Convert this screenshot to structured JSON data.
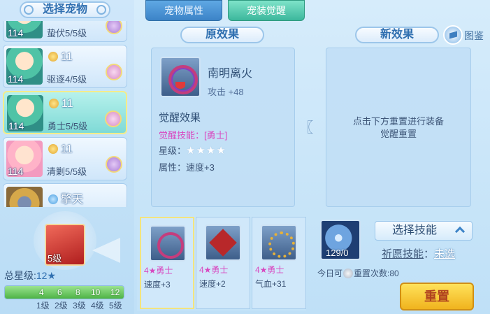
{
  "left": {
    "title": "选择宠物",
    "pets": [
      {
        "level": "114",
        "power": "",
        "skill": "蛰伏5/5级"
      },
      {
        "level": "114",
        "power": "11",
        "skill": "驱逐4/5级"
      },
      {
        "level": "114",
        "power": "11",
        "skill": "勇士5/5级",
        "selected": true
      },
      {
        "level": "114",
        "power": "11",
        "skill": "清剿5/5级"
      },
      {
        "level": "",
        "power": "擎天",
        "skill": ""
      }
    ],
    "char_level": "5级",
    "total_stars_label": "总星级:",
    "total_stars_value": "12★",
    "progress_fraction": 1.0,
    "ticks": [
      "4",
      "6",
      "8",
      "10",
      "12"
    ],
    "levels": [
      "1级",
      "2级",
      "3级",
      "4级",
      "5级"
    ]
  },
  "tabs": {
    "pet_attr": "宠物属性",
    "pet_gear_awaken": "宠装觉醒"
  },
  "original": {
    "section": "原效果",
    "item_name": "南明离火",
    "item_stat": "攻击 +48",
    "awaken_title": "觉醒效果",
    "awaken_skill": "觉醒技能：[勇士]",
    "star_label": "星级：",
    "stars": "★★★★",
    "attr": "属性：速度+3"
  },
  "new": {
    "section": "新效果",
    "atlas": "图鉴",
    "hint_line1": "点击下方重置进行装备",
    "hint_line2": "觉醒重置"
  },
  "candidates": [
    {
      "tag": "4★勇士",
      "stat": "速度+3",
      "icon": "ruby-necklace-icon"
    },
    {
      "tag": "4★勇士",
      "stat": "速度+2",
      "icon": "red-gem-icon"
    },
    {
      "tag": "4★勇士",
      "stat": "气血+31",
      "icon": "gold-necklace-icon"
    }
  ],
  "right": {
    "orb_count": "129/0",
    "select_skill": "选择技能",
    "wish_key": "祈愿技能",
    "wish_sep": "：",
    "wish_val": "未选",
    "today_prefix": "今日可",
    "today_suffix": "重置次数:80",
    "reset": "重置"
  }
}
